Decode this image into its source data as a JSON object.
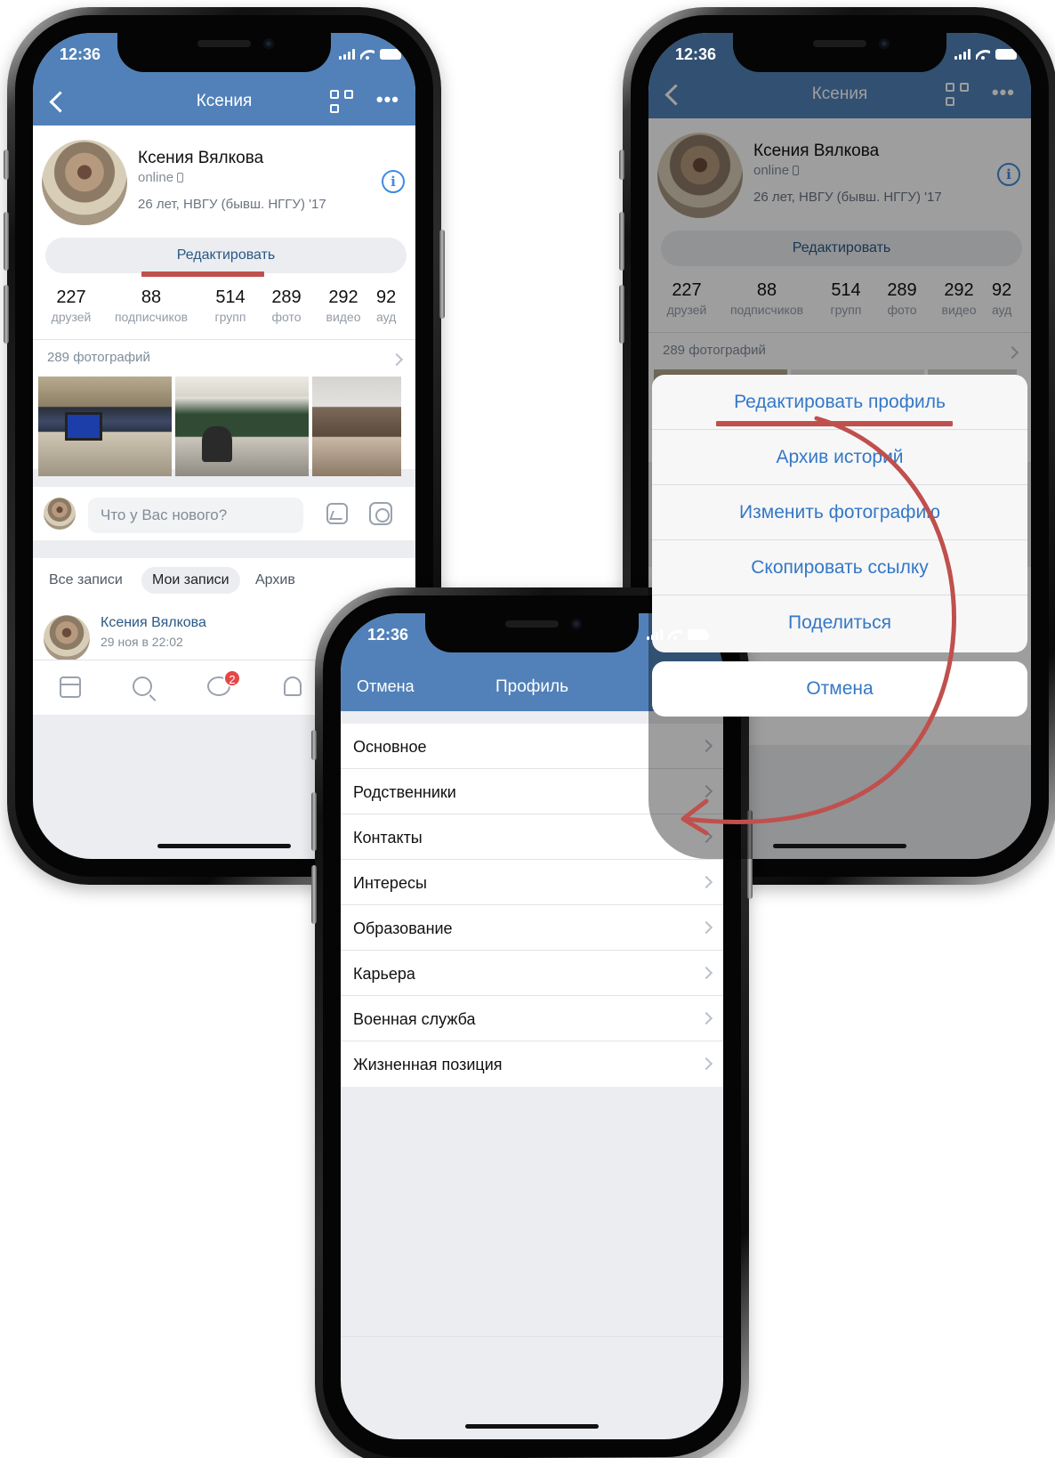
{
  "colors": {
    "accent_red": "#c0504d",
    "vk_blue": "#5181b8",
    "link_blue": "#3478c6"
  },
  "phone1": {
    "status_time": "12:36",
    "nav": {
      "title": "Ксения",
      "back_icon": "chevron-left-icon",
      "qr_icon": "qr-code-icon",
      "more_icon": "more-dots-icon"
    },
    "profile": {
      "name": "Ксения Вялкова",
      "status": "online",
      "info": "26 лет, НВГУ (бывш. НГГУ) '17"
    },
    "edit_button": "Редактировать",
    "stats": [
      {
        "n": "227",
        "l": "друзей"
      },
      {
        "n": "88",
        "l": "подписчиков"
      },
      {
        "n": "514",
        "l": "групп"
      },
      {
        "n": "289",
        "l": "фото"
      },
      {
        "n": "292",
        "l": "видео"
      },
      {
        "n": "92",
        "l": "ауд"
      }
    ],
    "photos_title": "289 фотографий",
    "composer_placeholder": "Что у Вас нового?",
    "tabs": [
      "Все записи",
      "Мои записи",
      "Архив"
    ],
    "post": {
      "author": "Ксения Вялкова",
      "date": "29 ноя в 22:02"
    },
    "messages_badge": "2"
  },
  "phone2": {
    "status_time": "12:36",
    "nav": {
      "title": "Ксения"
    },
    "profile": {
      "name": "Ксения Вялкова",
      "status": "online",
      "info": "26 лет, НВГУ (бывш. НГГУ) '17"
    },
    "edit_button": "Редактировать",
    "stats": [
      {
        "n": "227",
        "l": "друзей"
      },
      {
        "n": "88",
        "l": "подписчиков"
      },
      {
        "n": "514",
        "l": "групп"
      },
      {
        "n": "289",
        "l": "фото"
      },
      {
        "n": "292",
        "l": "видео"
      },
      {
        "n": "92",
        "l": "ауд"
      }
    ],
    "photos_title": "289 фотографий",
    "sheet": [
      "Редактировать профиль",
      "Архив историй",
      "Изменить фотографию",
      "Скопировать ссылку",
      "Поделиться"
    ],
    "cancel": "Отмена"
  },
  "phone3": {
    "status_time": "12:36",
    "nav": {
      "cancel": "Отмена",
      "title": "Профиль"
    },
    "items": [
      "Основное",
      "Родственники",
      "Контакты",
      "Интересы",
      "Образование",
      "Карьера",
      "Военная служба",
      "Жизненная позиция"
    ]
  }
}
